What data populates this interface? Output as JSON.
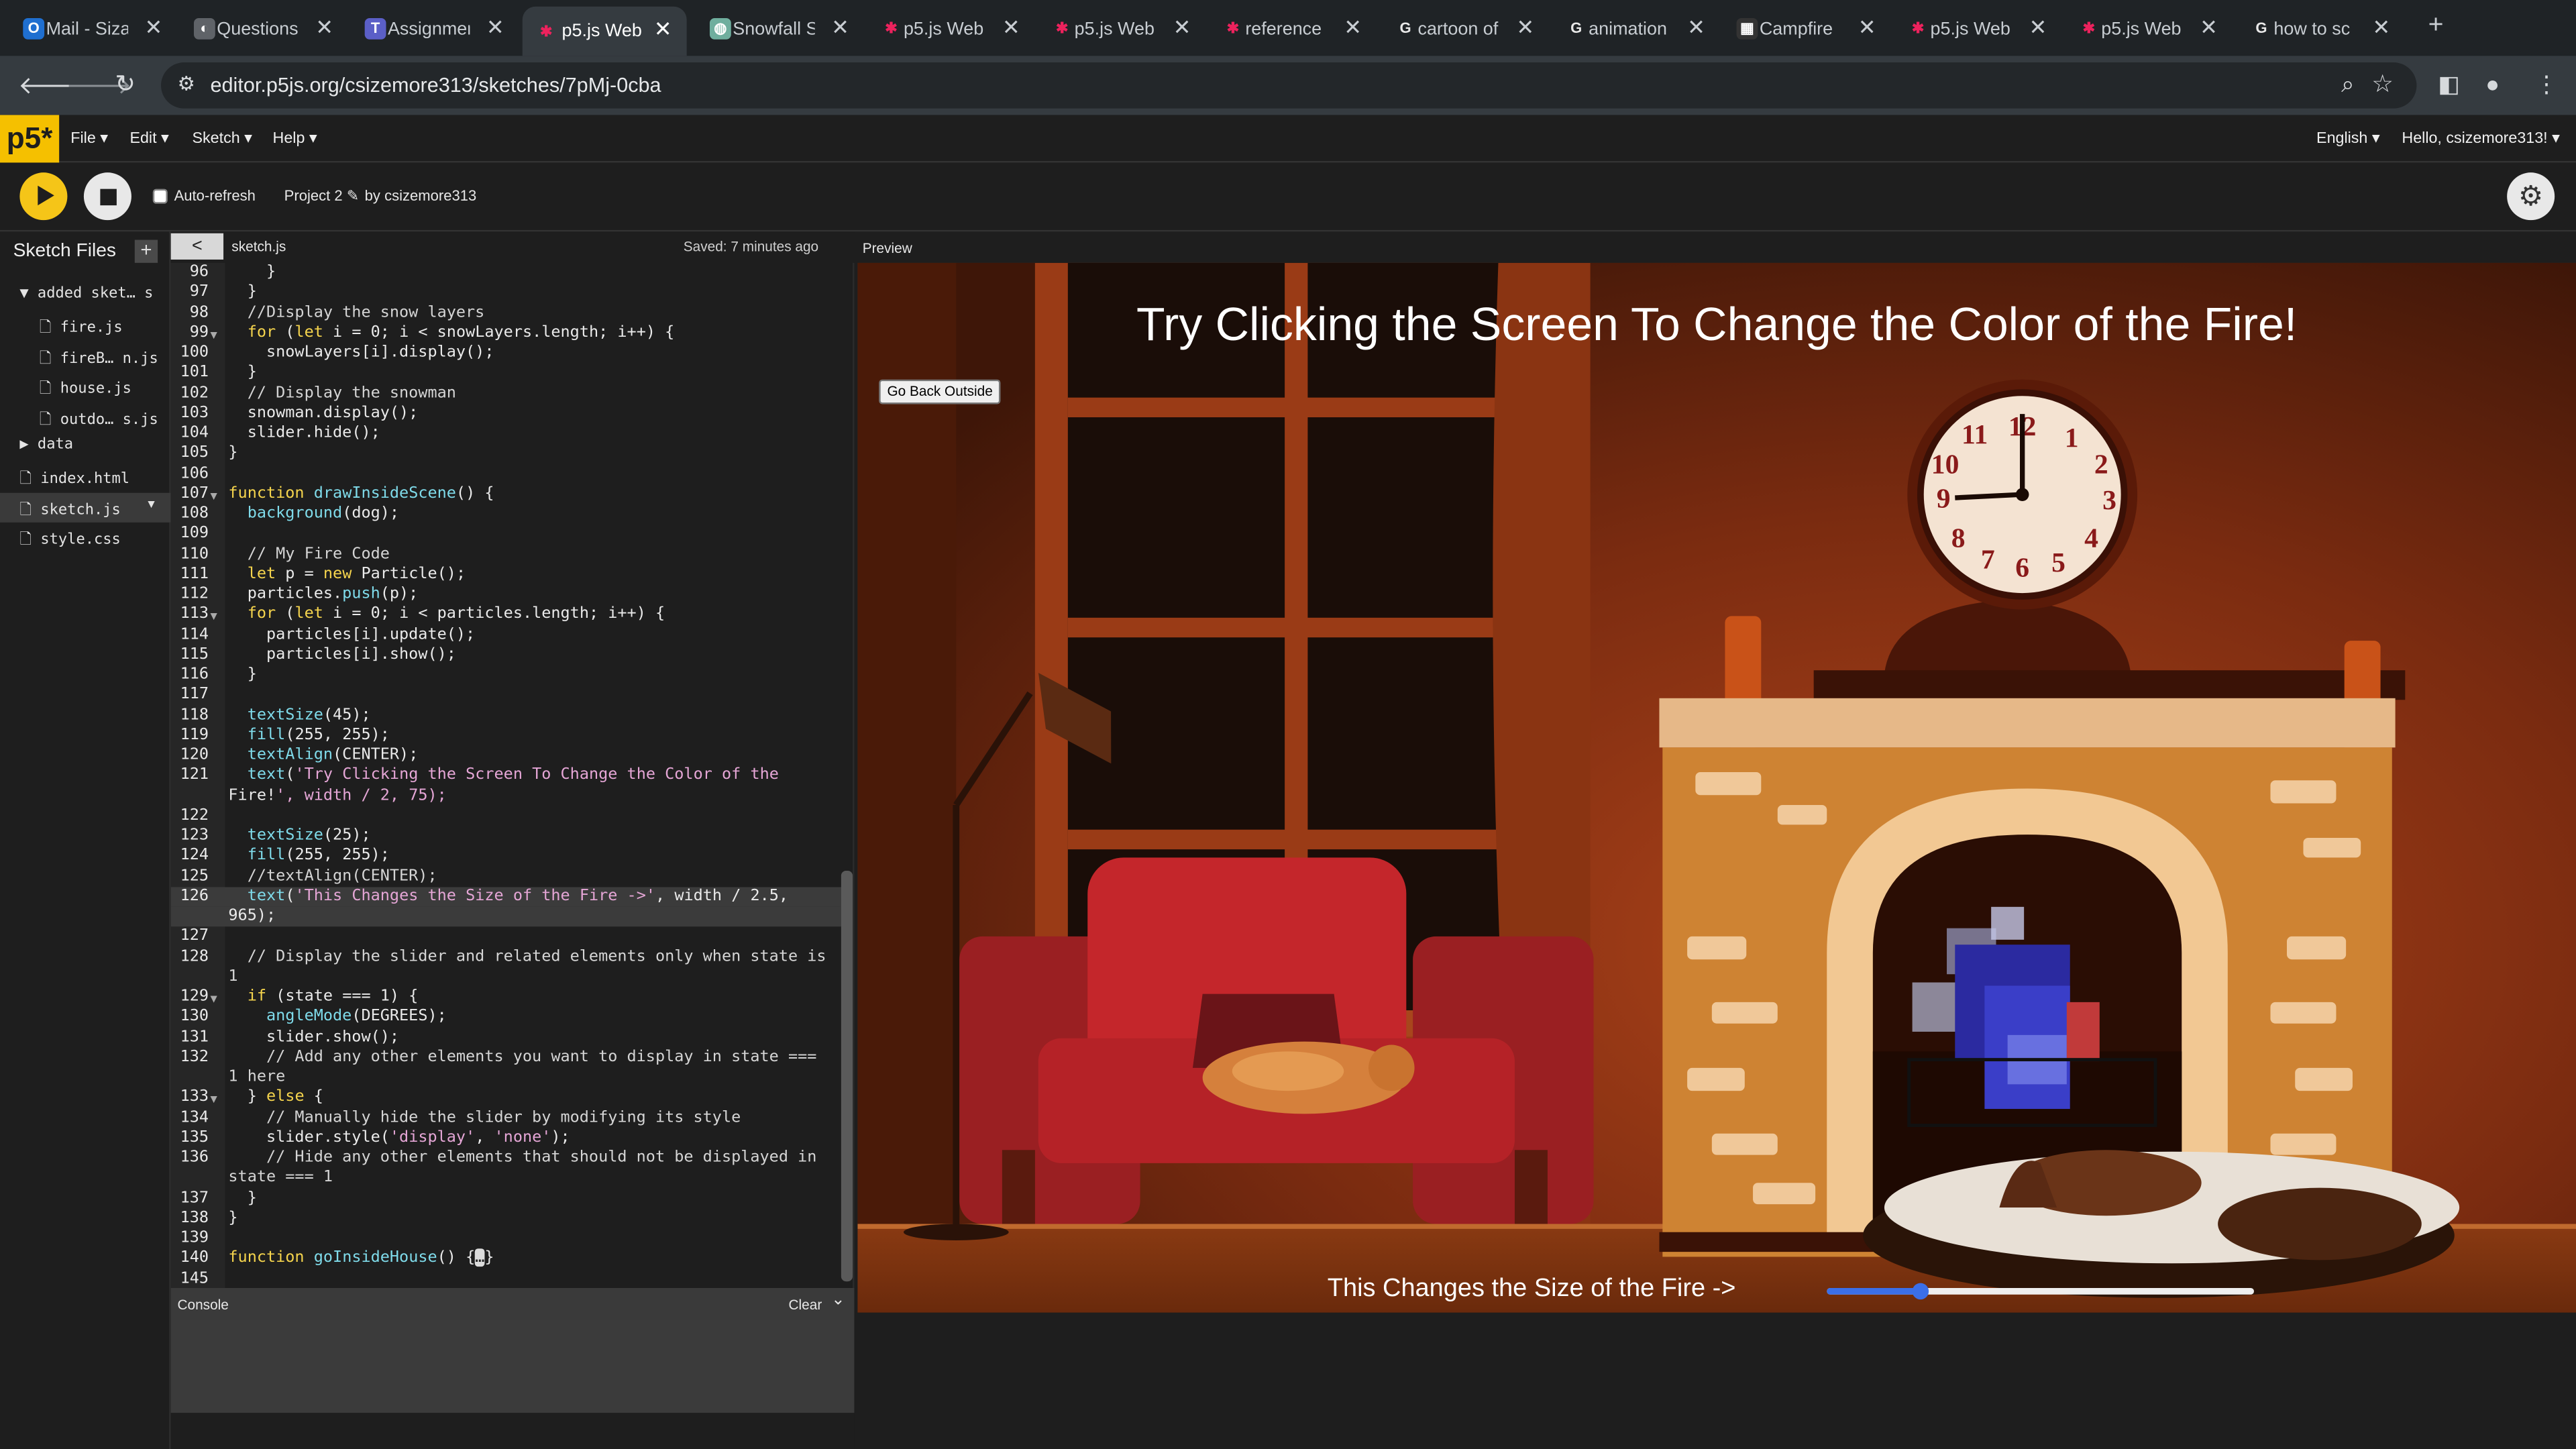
{
  "browser": {
    "tabs": [
      {
        "label": "Mail - Siza",
        "icon": "outlook-icon"
      },
      {
        "label": "Questions",
        "icon": "browser-icon"
      },
      {
        "label": "Assignment",
        "icon": "teams-icon"
      },
      {
        "label": "p5.js Web",
        "icon": "p5-icon",
        "active": true
      },
      {
        "label": "Snowfall S",
        "icon": "snowfall-icon"
      },
      {
        "label": "p5.js Web",
        "icon": "p5-icon"
      },
      {
        "label": "p5.js Web",
        "icon": "p5-icon"
      },
      {
        "label": "reference",
        "icon": "p5-icon"
      },
      {
        "label": "cartoon of",
        "icon": "google-icon"
      },
      {
        "label": "animation",
        "icon": "google-icon"
      },
      {
        "label": "Campfire",
        "icon": "campfire-icon"
      },
      {
        "label": "p5.js Web",
        "icon": "p5-icon"
      },
      {
        "label": "p5.js Web",
        "icon": "p5-icon"
      },
      {
        "label": "how to sc",
        "icon": "google-icon"
      }
    ],
    "url": "editor.p5js.org/csizemore313/sketches/7pMj-0cba"
  },
  "p5": {
    "logo": "p5*",
    "menus": [
      "File ▾",
      "Edit ▾",
      "Sketch ▾",
      "Help ▾"
    ],
    "language": "English ▾",
    "greeting": "Hello, csizemore313! ▾",
    "auto_refresh": "Auto-refresh",
    "project": "Project 2 ✎",
    "by": "by csizemore313"
  },
  "sidebar": {
    "title": "Sketch Files",
    "add": "+",
    "files": [
      {
        "label": "▼  added sket… s",
        "indent": 12,
        "bold": false
      },
      {
        "label": "🗋 fire.js",
        "indent": 24
      },
      {
        "label": "🗋 fireB… n.js",
        "indent": 24
      },
      {
        "label": "🗋 house.js",
        "indent": 24
      },
      {
        "label": "🗋 outdo… s.js",
        "indent": 24
      },
      {
        "label": "▶  data",
        "indent": 12
      },
      {
        "label": "🗋 index.html",
        "indent": 12
      },
      {
        "label": "🗋 sketch.js",
        "indent": 12,
        "selected": true,
        "caret": "▼"
      },
      {
        "label": "🗋 style.css",
        "indent": 12
      }
    ]
  },
  "editor": {
    "file": "sketch.js",
    "saved": "Saved: 7 minutes ago",
    "collapse": "<",
    "lines": [
      {
        "n": "96",
        "c": "    }"
      },
      {
        "n": "97",
        "c": "  }"
      },
      {
        "n": "98",
        "c": "  //Display the snow layers",
        "cls": "cm"
      },
      {
        "n": "99",
        "c": "  for (let i = 0; i < snowLayers.length; i++) {",
        "fold": true
      },
      {
        "n": "100",
        "c": "    snowLayers[i].display();"
      },
      {
        "n": "101",
        "c": "  }"
      },
      {
        "n": "102",
        "c": "  // Display the snowman",
        "cls": "cm"
      },
      {
        "n": "103",
        "c": "  snowman.display();"
      },
      {
        "n": "104",
        "c": "  slider.hide();"
      },
      {
        "n": "105",
        "c": "}"
      },
      {
        "n": "106",
        "c": ""
      },
      {
        "n": "107",
        "c": "function drawInsideScene() {",
        "fold": true
      },
      {
        "n": "108",
        "c": "  background(dog);"
      },
      {
        "n": "109",
        "c": ""
      },
      {
        "n": "110",
        "c": "  // My Fire Code",
        "cls": "cm"
      },
      {
        "n": "111",
        "c": "  let p = new Particle();"
      },
      {
        "n": "112",
        "c": "  particles.push(p);"
      },
      {
        "n": "113",
        "c": "  for (let i = 0; i < particles.length; i++) {",
        "fold": true
      },
      {
        "n": "114",
        "c": "    particles[i].update();"
      },
      {
        "n": "115",
        "c": "    particles[i].show();"
      },
      {
        "n": "116",
        "c": "  }"
      },
      {
        "n": "117",
        "c": ""
      },
      {
        "n": "118",
        "c": "  textSize(45);"
      },
      {
        "n": "119",
        "c": "  fill(255, 255);"
      },
      {
        "n": "120",
        "c": "  textAlign(CENTER);"
      },
      {
        "n": "121",
        "c": "  text('Try Clicking the Screen To Change the Color of the"
      },
      {
        "n": "",
        "c": "Fire!', width / 2, 75);"
      },
      {
        "n": "122",
        "c": ""
      },
      {
        "n": "123",
        "c": "  textSize(25);"
      },
      {
        "n": "124",
        "c": "  fill(255, 255);"
      },
      {
        "n": "125",
        "c": "  //textAlign(CENTER);",
        "cls": "cm"
      },
      {
        "n": "126",
        "c": "  text('This Changes the Size of the Fire ->', width / 2.5,",
        "hl": true
      },
      {
        "n": "",
        "c": "965);",
        "hl": true
      },
      {
        "n": "127",
        "c": ""
      },
      {
        "n": "128",
        "c": "  // Display the slider and related elements only when state is",
        "cls": "cm"
      },
      {
        "n": "",
        "c": "1",
        "cls": "cm"
      },
      {
        "n": "129",
        "c": "  if (state === 1) {",
        "fold": true
      },
      {
        "n": "130",
        "c": "    angleMode(DEGREES);"
      },
      {
        "n": "131",
        "c": "    slider.show();"
      },
      {
        "n": "132",
        "c": "    // Add any other elements you want to display in state ===",
        "cls": "cm"
      },
      {
        "n": "",
        "c": "1 here",
        "cls": "cm"
      },
      {
        "n": "133",
        "c": "  } else {",
        "fold": true
      },
      {
        "n": "134",
        "c": "    // Manually hide the slider by modifying its style",
        "cls": "cm"
      },
      {
        "n": "135",
        "c": "    slider.style('display', 'none');"
      },
      {
        "n": "136",
        "c": "    // Hide any other elements that should not be displayed in",
        "cls": "cm"
      },
      {
        "n": "",
        "c": "state === 1",
        "cls": "cm"
      },
      {
        "n": "137",
        "c": "  }"
      },
      {
        "n": "138",
        "c": "}"
      },
      {
        "n": "139",
        "c": ""
      },
      {
        "n": "140",
        "c": "function goInsideHouse() {…}"
      },
      {
        "n": "145",
        "c": ""
      }
    ]
  },
  "console": {
    "title": "Console",
    "clear": "Clear"
  },
  "preview": {
    "title": "Preview",
    "canvas_title": "Try Clicking the Screen To Change the Color of the Fire!",
    "go_back": "Go Back Outside",
    "size_label": "This Changes the Size of the Fire ->",
    "slider_value": 0.22,
    "clock_numbers": [
      "12",
      "1",
      "2",
      "3",
      "4",
      "5",
      "6",
      "7",
      "8",
      "9",
      "10",
      "11"
    ]
  },
  "colors": {
    "accent": "#ed225d",
    "play": "#f5c518",
    "slider": "#3b6fe8"
  }
}
